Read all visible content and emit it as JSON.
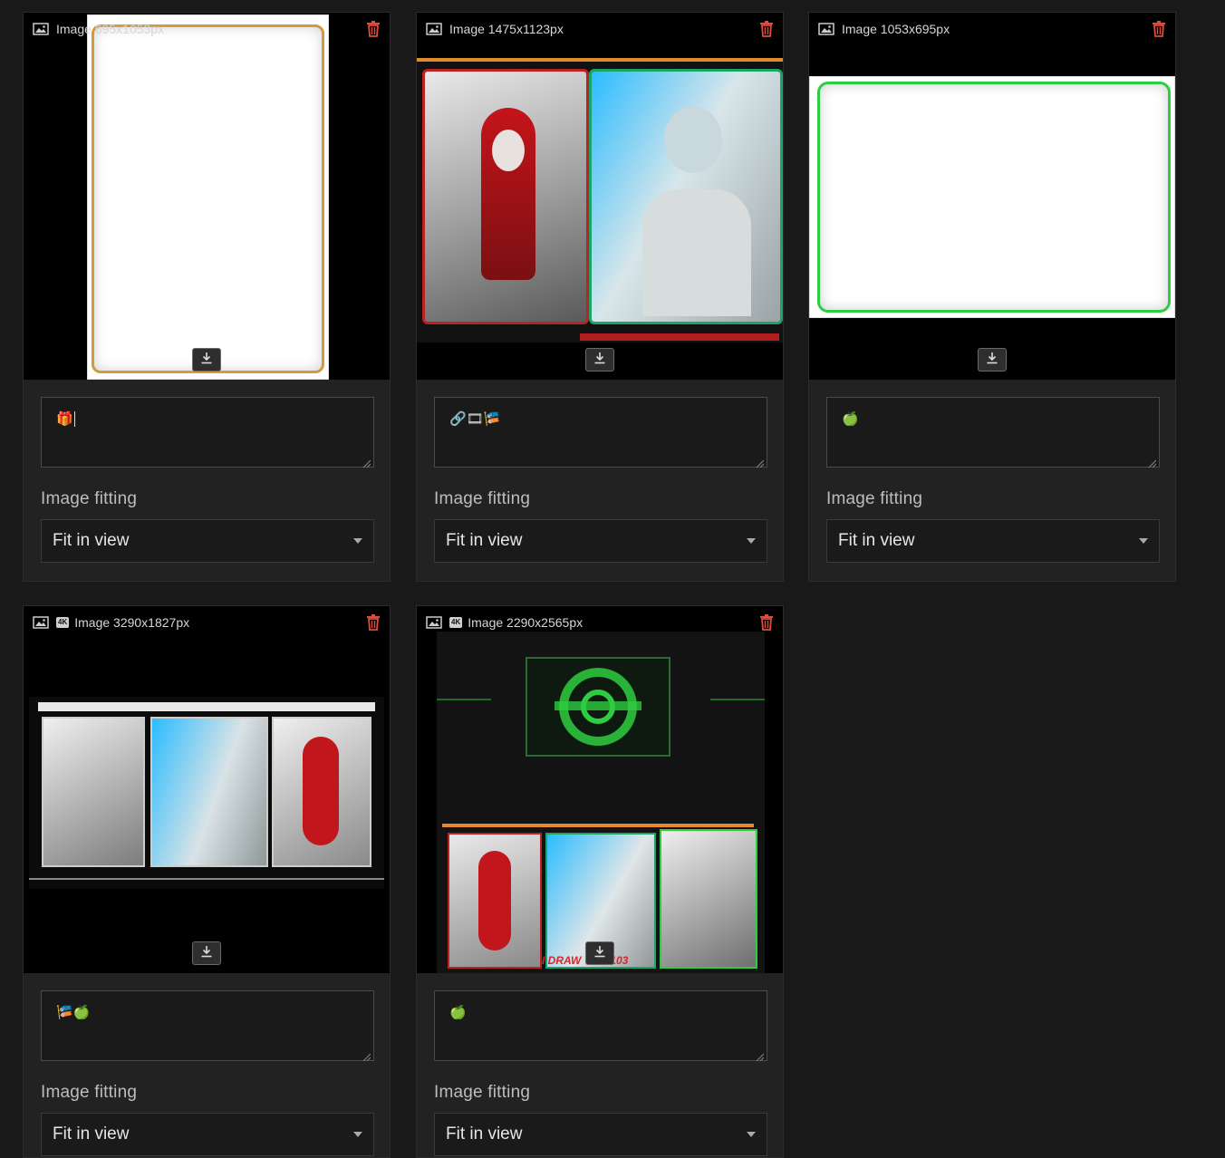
{
  "common": {
    "fit_label": "Image fitting",
    "fit_value": "Fit in view",
    "badge_4k": "4K"
  },
  "cards": [
    {
      "title": "Image 695x1053px",
      "caption": "🎁"
    },
    {
      "title": "Image 1475x1123px",
      "caption": "🔗🎞🎏"
    },
    {
      "title": "Image 1053x695px",
      "caption": "🍏"
    },
    {
      "title": "Image 3290x1827px",
      "caption": "🎏🍏"
    },
    {
      "title": "Image 2290x2565px",
      "caption": "🍏"
    }
  ],
  "overlay_text": {
    "banner_partial": "I DRAW    LS 103"
  },
  "colors": {
    "background": "#191919",
    "card": "#222222",
    "trash": "#e04b3a",
    "green_accent": "#2ecc40",
    "red_accent": "#d9262b",
    "cyan_accent": "#26c6ff",
    "orange_accent": "#e08a2c"
  }
}
